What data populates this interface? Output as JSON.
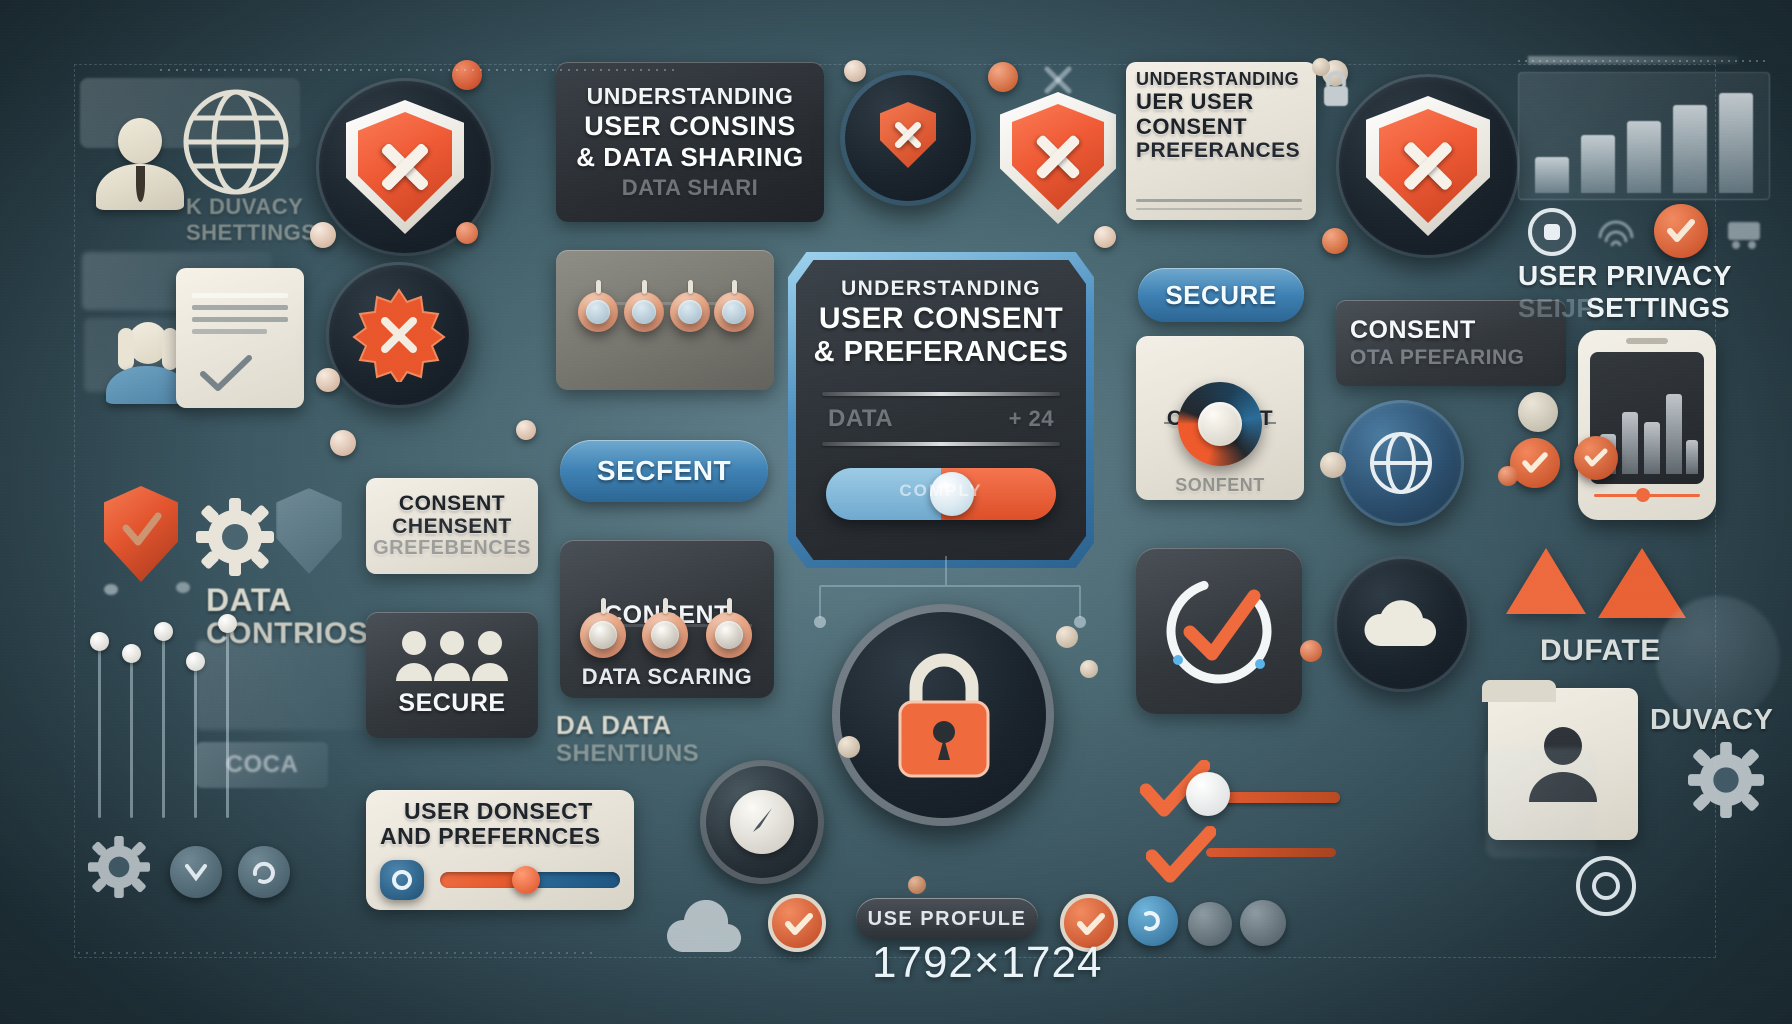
{
  "meta": {
    "watermark": "1792×1724",
    "canvas_bg": "#46656f",
    "accent_orange": "#ef5a35",
    "accent_blue": "#3f82b4",
    "panel_light": "#f0ece2",
    "panel_dark": "#2f343a"
  },
  "top_row": {
    "left_group": {
      "privacy_label_line1": "K DUVACY",
      "privacy_label_line2": "SHETTINGS",
      "user_icon": "user-avatar-icon",
      "globe_icon": "globe-icon"
    },
    "headline_card": {
      "line1": "UNDERSTANDING",
      "line2": "USER CONSINS",
      "line3": "& DATA SHARING",
      "line4": "DATA SHARI"
    },
    "right_card": {
      "line1": "UNDERSTANDING",
      "line2": "UER USER",
      "line3": "CONSENT",
      "line4": "PREFERANCES"
    },
    "far_right": {
      "line1": "USER PRIVACY",
      "line2_ghost": "SEIJF",
      "line2": "SETTINGS"
    }
  },
  "mid_row": {
    "consent_prefs_card": {
      "line1": "CONSENT",
      "line2": "CHENSENT",
      "line3": "GREFEBENCES"
    },
    "secfent_button": {
      "label": "SECFENT"
    },
    "secure_button_right": {
      "label": "SECURE"
    },
    "consent_knob_card": {
      "title": "CONSENT",
      "subtitle": "SONFENT"
    },
    "consent_sharing_card": {
      "line1": "CONSENT",
      "line2": "OTA PFEFARING"
    },
    "center_panel": {
      "kicker": "UNDERSTANDING",
      "line1": "USER CONSENT",
      "line2": "& PREFERANCES",
      "field_label": "DATA",
      "field_value": "+ 24",
      "toggle_label": "COMPLY"
    }
  },
  "lower_row": {
    "secure_people_card": {
      "label": "SECURE"
    },
    "consent_data_card": {
      "title": "CONSENT",
      "subtitle": "DATA SCARING",
      "knob_count": 3
    },
    "data_shentiuns": {
      "line1": "DA DATA",
      "line2": "SHENTIUNS"
    },
    "data_controls": {
      "line1": "DATA",
      "line2": "CONTRIOS"
    },
    "duvate_label": "DUFATE",
    "duvacy_label": "DUVACY"
  },
  "bottom_row": {
    "user_consent_card": {
      "line1": "USER DONSECT",
      "line2": "AND PREFERNCES",
      "toggle_state": "on",
      "slider_value": 45
    },
    "use_profile_badge": {
      "label": "USE PROFULE"
    },
    "lock_icon": "padlock-icon",
    "cloud_icon": "cloud-icon",
    "gauge_icon": "gauge-icon"
  },
  "icons": {
    "shield_x": "shield-with-x-icon",
    "shield_check": "shield-check-icon",
    "gear": "gear-icon",
    "globe": "globe-icon",
    "person": "person-icon",
    "lock": "padlock-icon",
    "cloud": "cloud-icon",
    "checkmark": "checkmark-icon",
    "badge_burst": "burst-badge-icon",
    "phone": "smartphone-icon",
    "document": "document-icon",
    "folder_person": "folder-person-icon"
  }
}
